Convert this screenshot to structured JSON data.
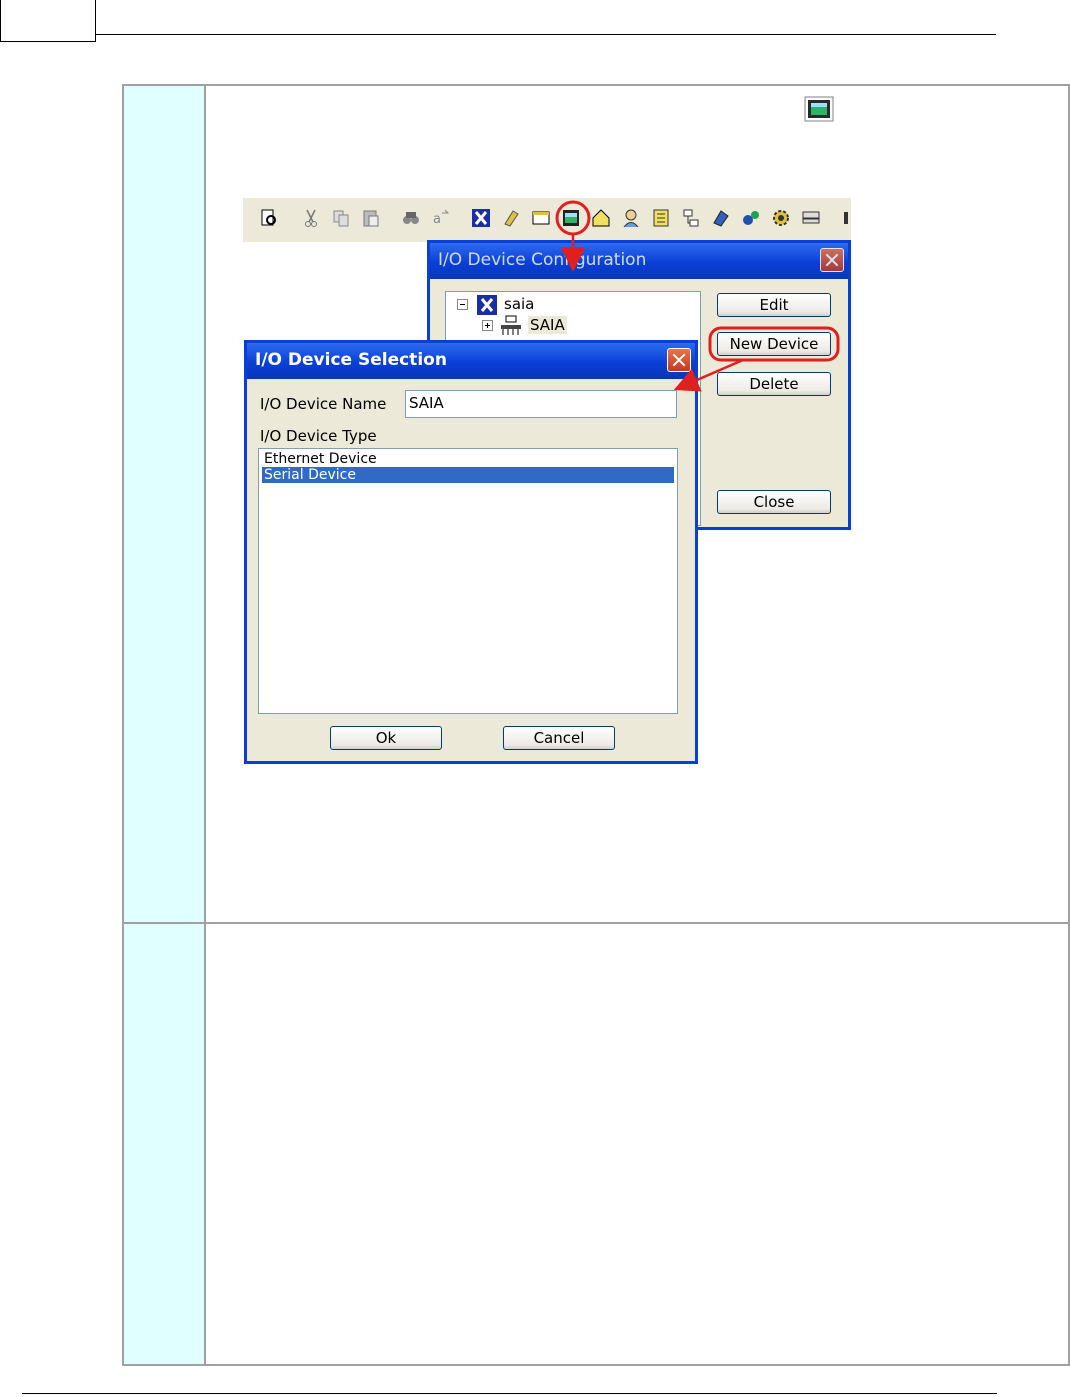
{
  "config_dialog": {
    "title": "I/O Device Configuration",
    "tree": {
      "root_label": "saia",
      "child_label": "SAIA"
    },
    "buttons": {
      "edit": "Edit",
      "new_device": "New Device",
      "delete": "Delete",
      "close": "Close"
    }
  },
  "selection_dialog": {
    "title": "I/O Device Selection",
    "name_label": "I/O Device Name",
    "name_value": "SAIA",
    "type_label": "I/O Device Type",
    "type_options": [
      {
        "label": "Ethernet Device",
        "selected": false
      },
      {
        "label": "Serial Device",
        "selected": true
      }
    ],
    "ok_label": "Ok",
    "cancel_label": "Cancel"
  },
  "colors": {
    "left_column": "#e0ffff",
    "xp_title_blue": "#0a3fd6",
    "highlight_red": "#e02020",
    "selection_blue": "#316ac5"
  }
}
